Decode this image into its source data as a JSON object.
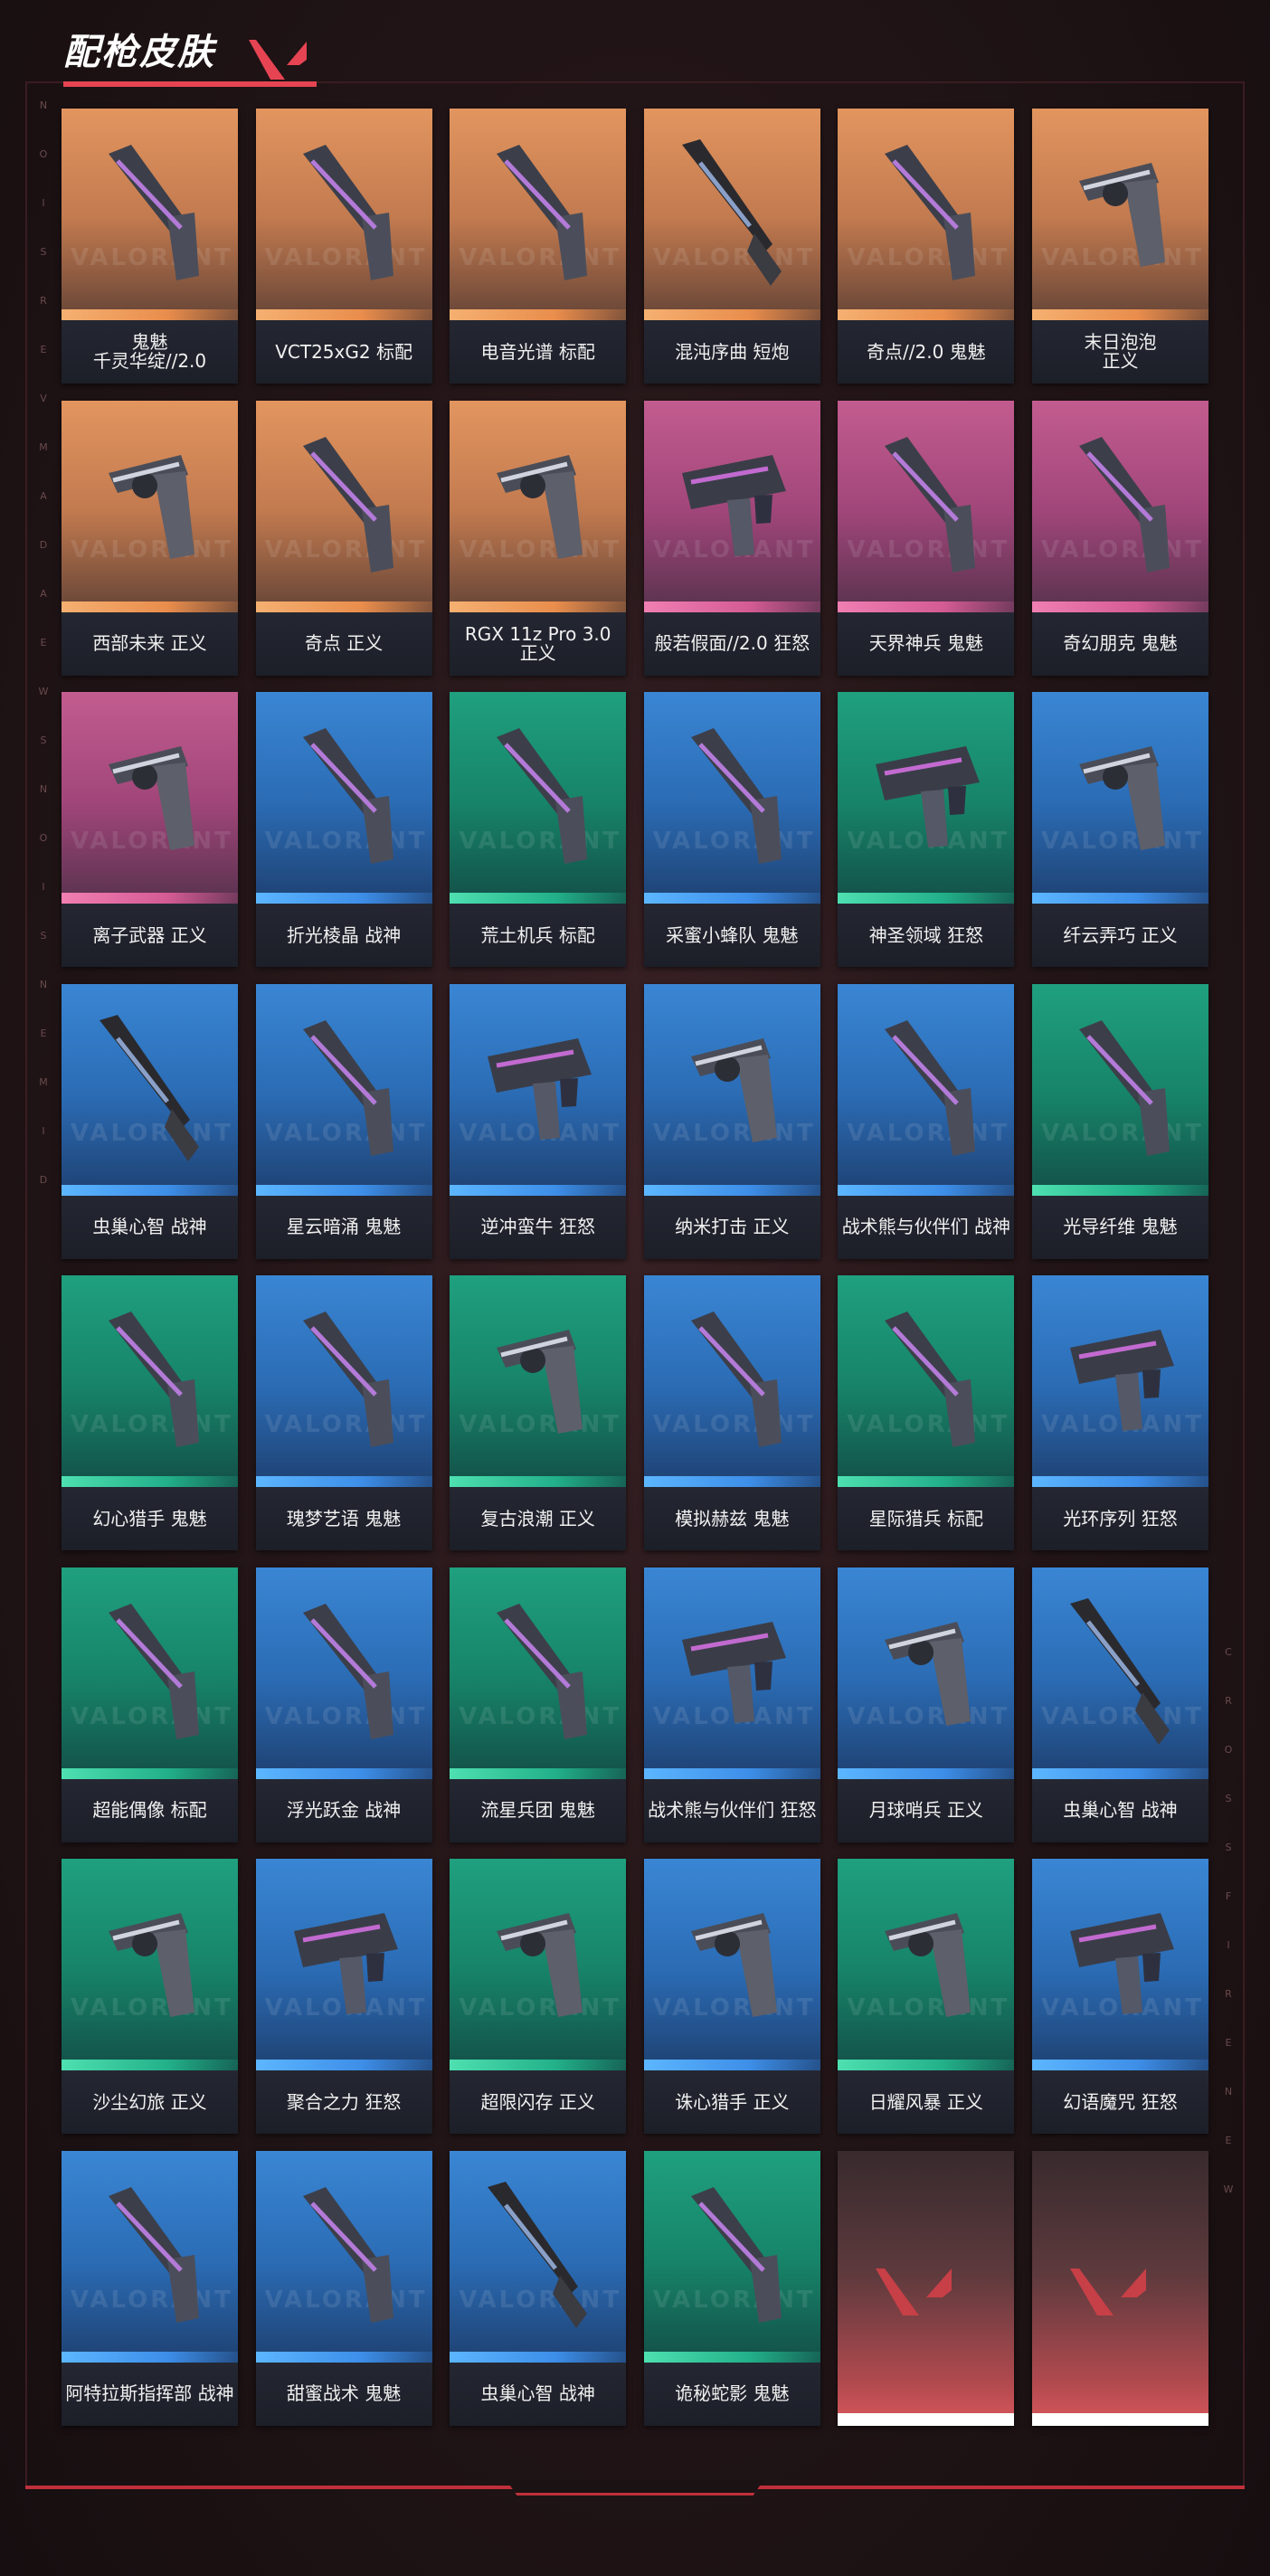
{
  "page": {
    "title": "配枪皮肤",
    "accent_color": "#e64452",
    "watermark_text": "VALORANT",
    "side_letters_left": [
      "N",
      "O",
      "I",
      "S",
      "R",
      "E",
      "V",
      "M",
      "A",
      "D",
      "A",
      "E",
      "W",
      "S",
      "N",
      "O",
      "I",
      "S",
      "N",
      "E",
      "M",
      "I",
      "D"
    ],
    "side_letters_right": [
      "C",
      "R",
      "O",
      "S",
      "S",
      "F",
      "I",
      "R",
      "E",
      "N",
      "E",
      "W"
    ]
  },
  "grid": {
    "cards": [
      {
        "label": "鬼魅\n千灵华绽//2.0",
        "tier_color": "orange",
        "icon": "pistol-icon"
      },
      {
        "label": "VCT25xG2 标配",
        "tier_color": "orange",
        "icon": "pistol-icon"
      },
      {
        "label": "电音光谱 标配",
        "tier_color": "orange",
        "icon": "pistol-icon"
      },
      {
        "label": "混沌序曲 短炮",
        "tier_color": "orange",
        "icon": "shotgun-icon"
      },
      {
        "label": "奇点//2.0 鬼魅",
        "tier_color": "orange",
        "icon": "pistol-icon"
      },
      {
        "label": "末日泡泡\n正义",
        "tier_color": "orange",
        "icon": "revolver-icon"
      },
      {
        "label": "西部未来 正义",
        "tier_color": "orange",
        "icon": "revolver-icon"
      },
      {
        "label": "奇点 正义",
        "tier_color": "orange",
        "icon": "pistol-icon"
      },
      {
        "label": "RGX 11z Pro 3.0\n正义",
        "tier_color": "orange",
        "icon": "revolver-icon"
      },
      {
        "label": "般若假面//2.0 狂怒",
        "tier_color": "pink",
        "icon": "smg-icon"
      },
      {
        "label": "天界神兵 鬼魅",
        "tier_color": "pink",
        "icon": "pistol-icon"
      },
      {
        "label": "奇幻朋克 鬼魅",
        "tier_color": "pink",
        "icon": "pistol-icon"
      },
      {
        "label": "离子武器 正义",
        "tier_color": "pink",
        "icon": "revolver-icon"
      },
      {
        "label": "折光棱晶 战神",
        "tier_color": "blue",
        "icon": "pistol-icon"
      },
      {
        "label": "荒土机兵 标配",
        "tier_color": "green",
        "icon": "pistol-icon"
      },
      {
        "label": "采蜜小蜂队 鬼魅",
        "tier_color": "blue",
        "icon": "pistol-icon"
      },
      {
        "label": "神圣领域 狂怒",
        "tier_color": "green",
        "icon": "smg-icon"
      },
      {
        "label": "纤云弄巧 正义",
        "tier_color": "blue",
        "icon": "revolver-icon"
      },
      {
        "label": "虫巢心智 战神",
        "tier_color": "blue",
        "icon": "shotgun-icon"
      },
      {
        "label": "星云暗涌 鬼魅",
        "tier_color": "blue",
        "icon": "pistol-icon"
      },
      {
        "label": "逆冲蛮牛 狂怒",
        "tier_color": "blue",
        "icon": "smg-icon"
      },
      {
        "label": "纳米打击 正义",
        "tier_color": "blue",
        "icon": "revolver-icon"
      },
      {
        "label": "战术熊与伙伴们 战神",
        "tier_color": "blue",
        "icon": "pistol-icon"
      },
      {
        "label": "光导纤维 鬼魅",
        "tier_color": "green",
        "icon": "pistol-icon"
      },
      {
        "label": "幻心猎手 鬼魅",
        "tier_color": "green",
        "icon": "pistol-icon"
      },
      {
        "label": "瑰梦艺语 鬼魅",
        "tier_color": "blue",
        "icon": "pistol-icon"
      },
      {
        "label": "复古浪潮 正义",
        "tier_color": "green",
        "icon": "revolver-icon"
      },
      {
        "label": "模拟赫兹 鬼魅",
        "tier_color": "blue",
        "icon": "pistol-icon"
      },
      {
        "label": "星际猎兵 标配",
        "tier_color": "green",
        "icon": "pistol-icon"
      },
      {
        "label": "光环序列 狂怒",
        "tier_color": "blue",
        "icon": "smg-icon"
      },
      {
        "label": "超能偶像 标配",
        "tier_color": "green",
        "icon": "pistol-icon"
      },
      {
        "label": "浮光跃金 战神",
        "tier_color": "blue",
        "icon": "pistol-icon"
      },
      {
        "label": "流星兵团 鬼魅",
        "tier_color": "green",
        "icon": "pistol-icon"
      },
      {
        "label": "战术熊与伙伴们 狂怒",
        "tier_color": "blue",
        "icon": "smg-icon"
      },
      {
        "label": "月球哨兵 正义",
        "tier_color": "blue",
        "icon": "revolver-icon"
      },
      {
        "label": "虫巢心智 战神",
        "tier_color": "blue",
        "icon": "shotgun-icon"
      },
      {
        "label": "沙尘幻旅 正义",
        "tier_color": "green",
        "icon": "revolver-icon"
      },
      {
        "label": "聚合之力 狂怒",
        "tier_color": "blue",
        "icon": "smg-icon"
      },
      {
        "label": "超限闪存 正义",
        "tier_color": "green",
        "icon": "revolver-icon"
      },
      {
        "label": "诛心猎手 正义",
        "tier_color": "blue",
        "icon": "revolver-icon"
      },
      {
        "label": "日耀风暴 正义",
        "tier_color": "green",
        "icon": "revolver-icon"
      },
      {
        "label": "幻语魔咒 狂怒",
        "tier_color": "blue",
        "icon": "smg-icon"
      },
      {
        "label": "阿特拉斯指挥部 战神",
        "tier_color": "blue",
        "icon": "pistol-icon"
      },
      {
        "label": "甜蜜战术 鬼魅",
        "tier_color": "blue",
        "icon": "pistol-icon"
      },
      {
        "label": "虫巢心智 战神",
        "tier_color": "blue",
        "icon": "shotgun-icon"
      },
      {
        "label": "诡秘蛇影 鬼魅",
        "tier_color": "green",
        "icon": "pistol-icon"
      },
      {
        "label": "",
        "tier_color": "empty",
        "icon": "valorant-logo-icon"
      },
      {
        "label": "",
        "tier_color": "empty",
        "icon": "valorant-logo-icon"
      }
    ]
  }
}
